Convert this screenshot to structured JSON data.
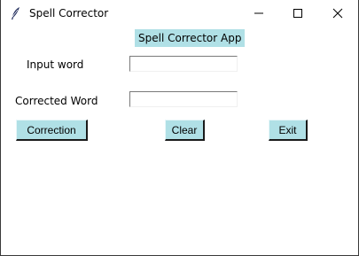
{
  "window": {
    "title": "Spell Corrector",
    "title_icon": "feather-icon",
    "controls": [
      "minimize-icon",
      "maximize-icon",
      "close-icon"
    ]
  },
  "app": {
    "heading": "Spell Corrector App",
    "heading_bg": "#b0e0e6"
  },
  "form": {
    "input_label": "Input word",
    "input_value": "",
    "corrected_label": "Corrected Word",
    "corrected_value": ""
  },
  "buttons": {
    "correction": "Correction",
    "clear": "Clear",
    "exit": "Exit",
    "bg": "#b0e0e6"
  }
}
